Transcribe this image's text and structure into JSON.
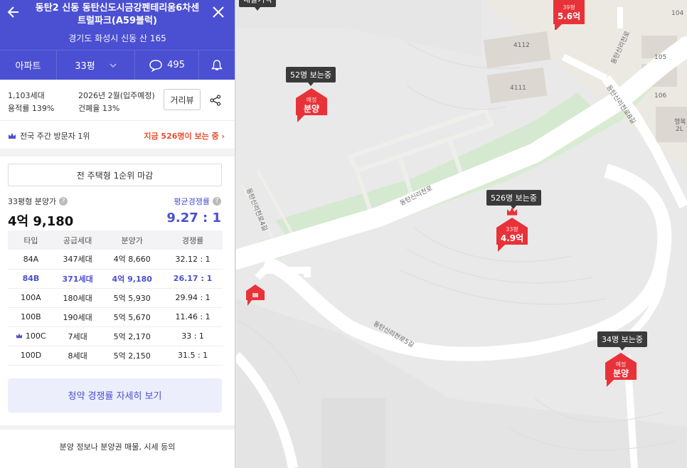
{
  "header": {
    "title_line1": "동탄2 신동 동탄신도시금강펜테리움6차센",
    "title_line2": "트럴파크(A59블럭)",
    "address": "경기도 화성시 신동 산 165"
  },
  "tabs": {
    "type": "아파트",
    "size": "33평",
    "comments": "495"
  },
  "meta": {
    "households": "1,103세대",
    "floor_area_ratio": "용적률 139%",
    "movein": "2026년 2월(입주예정)",
    "building_coverage": "건폐율 13%",
    "distance_view": "거리뷰"
  },
  "rank": {
    "left": "전국 주간 방문자 1위",
    "right": "지금 526명이 보는 중 ›"
  },
  "notice": "전 주택형 1순위 마감",
  "price": {
    "label": "33평형 분양가",
    "value": "4억 9,180",
    "comp_label": "평균경쟁률",
    "comp_value": "9.27 : 1"
  },
  "table": {
    "headers": [
      "타입",
      "공급세대",
      "분양가",
      "경쟁률"
    ],
    "rows": [
      {
        "type": "84A",
        "units": "347세대",
        "price": "4억 8,660",
        "ratio": "32.12 : 1"
      },
      {
        "type": "84B",
        "units": "371세대",
        "price": "4억 9,180",
        "ratio": "26.17 : 1"
      },
      {
        "type": "100A",
        "units": "180세대",
        "price": "5억 5,930",
        "ratio": "29.94 : 1"
      },
      {
        "type": "100B",
        "units": "190세대",
        "price": "5억 5,670",
        "ratio": "11.46 : 1"
      },
      {
        "type": "100C",
        "units": "7세대",
        "price": "5억 2,170",
        "ratio": "33 : 1"
      },
      {
        "type": "100D",
        "units": "8세대",
        "price": "5억 2,150",
        "ratio": "31.5 : 1"
      }
    ]
  },
  "detail_button": "청약 경쟁률 자세히 보기",
  "footer_text": "분양 정보나 분양권 매물, 시세 등의",
  "map": {
    "road_labels": [
      "동탄신리천로",
      "동탄신리천로4길",
      "동탄신리천로5길",
      "동탄신리천로8길",
      "동탄신리천로"
    ],
    "building_labels": [
      "4112",
      "4111",
      "105",
      "106",
      "104"
    ],
    "partial_labels": [
      "행복",
      "2L"
    ],
    "markers": [
      {
        "viewers": "52명 보는중",
        "small": "예정",
        "big": "분양"
      },
      {
        "viewers": "526명 보는중",
        "small": "33평",
        "big": "4.9억"
      },
      {
        "viewers": "34명 보는중",
        "small": "예정",
        "big": "분양"
      },
      {
        "viewers": "",
        "small": "39평",
        "big": "5.6억"
      }
    ],
    "top_partial": "내발기억"
  },
  "colors": {
    "brand": "#4b4fd2",
    "marker": "#e8323a",
    "hot": "#ea4c2d"
  }
}
